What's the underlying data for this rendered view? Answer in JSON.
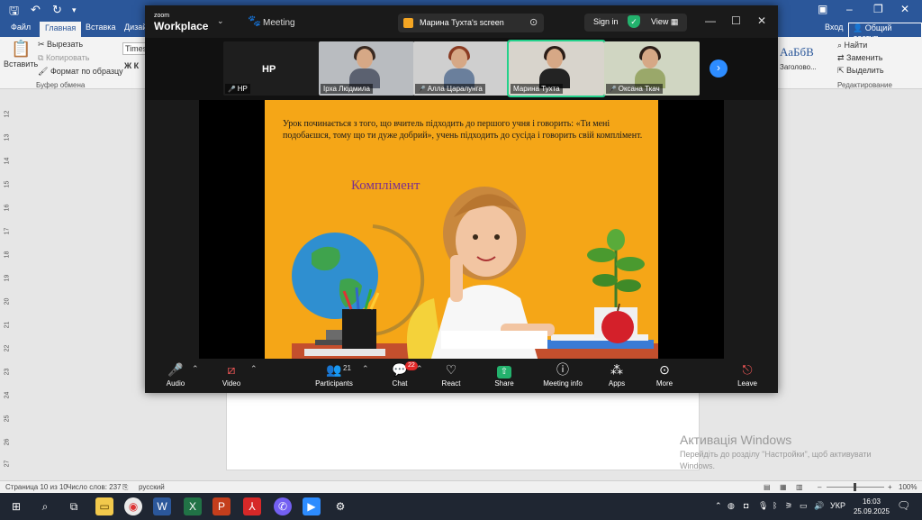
{
  "word": {
    "tabs": [
      "Файл",
      "Главная",
      "Вставка",
      "Дизай"
    ],
    "active_tab": "Главная",
    "account": {
      "login": "Вход",
      "share": "Общий доступ"
    },
    "clipboard": {
      "paste": "Вставить",
      "cut": "Вырезать",
      "copy": "Копировать",
      "format_painter": "Формат по образцу",
      "group": "Буфер обмена"
    },
    "font_name": "Times",
    "font_buttons": "Ж К",
    "styles": {
      "sample": "АаБбВ",
      "heading": "Заголово..."
    },
    "editing": {
      "find": "Найти",
      "replace": "Заменить",
      "select": "Выделить",
      "group": "Редактирование"
    },
    "ruler": [
      "12",
      "13",
      "14",
      "15",
      "16",
      "17",
      "18",
      "19",
      "20",
      "21",
      "22",
      "23",
      "24",
      "25",
      "26",
      "27"
    ],
    "status": {
      "page": "Страница 10 из 10",
      "words": "Число слов: 237",
      "lang": "русский",
      "zoom": "100%"
    }
  },
  "activation": {
    "title": "Активація Windows",
    "subtitle": "Перейдіть до розділу \"Настройки\", щоб активувати Windows."
  },
  "zoom": {
    "logo_top": "zoom",
    "logo_bottom": "Workplace",
    "meeting_label": "Meeting",
    "share_title": "Марина Тухта's screen",
    "sign_in": "Sign in",
    "view": "View",
    "gallery": [
      {
        "name": "HP",
        "label": "HP"
      },
      {
        "name": "Ірха Людмила"
      },
      {
        "name": "Алла Царалунга"
      },
      {
        "name": "Марина Тухта"
      },
      {
        "name": "Оксана Ткач"
      }
    ],
    "slide": {
      "text": "Урок починається з того, що вчитель підходить до першого учня і говорить: «Ти мені подобаєшся, тому що ти дуже добрий», учень підходить до сусіда і говорить свій комплімент.",
      "heading": "Комплімент"
    },
    "controls": {
      "audio": "Audio",
      "video": "Video",
      "participants": "Participants",
      "participants_count": "21",
      "chat": "Chat",
      "chat_badge": "22",
      "react": "React",
      "share": "Share",
      "meeting_info": "Meeting info",
      "apps": "Apps",
      "more": "More",
      "leave": "Leave"
    }
  },
  "taskbar": {
    "lang": "УКР",
    "time": "16:03",
    "date": "25.09.2025"
  },
  "colors": {
    "word_blue": "#2b579a",
    "zoom_dark": "#1a1a1a",
    "slide_orange": "#f5a617",
    "heading_purple": "#7b2e8f",
    "active_green": "#23d18b"
  }
}
